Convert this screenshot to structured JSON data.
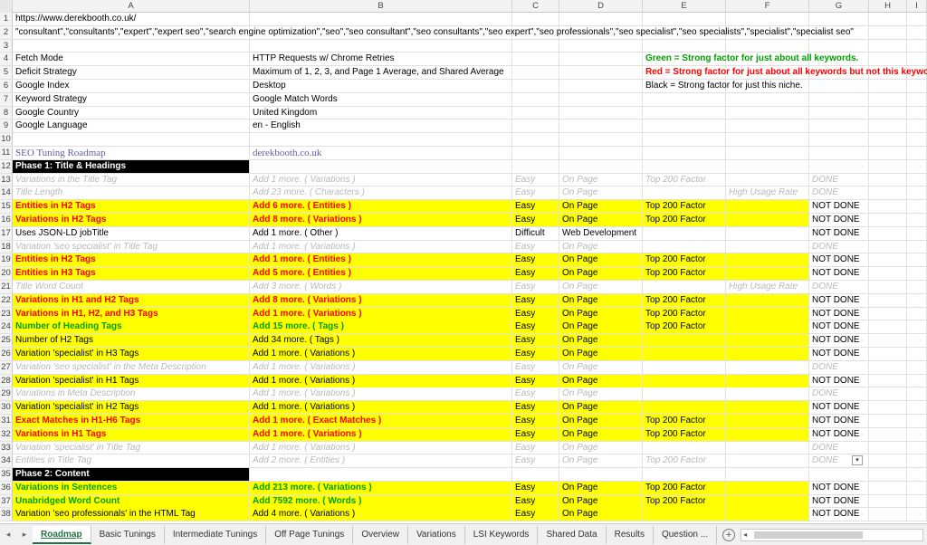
{
  "columns": [
    "",
    "A",
    "B",
    "C",
    "D",
    "E",
    "F",
    "G",
    "H",
    "I"
  ],
  "url": "https://www.derekbooth.co.uk/",
  "keywords": "\"consultant\",\"consultants\",\"expert\",\"expert seo\",\"search engine optimization\",\"seo\",\"seo consultant\",\"seo consultants\",\"seo expert\",\"seo professionals\",\"seo specialist\",\"seo specialists\",\"specialist\",\"specialist seo\"",
  "settings": [
    {
      "label": "Fetch Mode",
      "value": "HTTP Requests w/ Chrome Retries"
    },
    {
      "label": "Deficit Strategy",
      "value": "Maximum of 1, 2, 3, and Page 1 Average, and Shared Average"
    },
    {
      "label": "Google Index",
      "value": "Desktop"
    },
    {
      "label": "Keyword Strategy",
      "value": "Google Match Words"
    },
    {
      "label": "Google Country",
      "value": "United Kingdom"
    },
    {
      "label": "Google Language",
      "value": "en - English"
    }
  ],
  "legend": {
    "green": "Green = Strong factor for just about all keywords.",
    "red": "Red = Strong factor for just about all keywords but not this keyword.",
    "black": "Black = Strong factor for just this niche."
  },
  "roadmap_title": "SEO Tuning Roadmap",
  "site": "derekbooth.co.uk",
  "phase1": "Phase 1: Title & Headings",
  "phase2": "Phase 2: Content",
  "rows_p1": [
    {
      "n": "13",
      "style": "grey",
      "a": "Variations in the Title Tag",
      "b": "Add 1 more. ( Variations )",
      "c": "Easy",
      "d": "On Page",
      "e": "Top 200 Factor",
      "f": "",
      "g": "DONE"
    },
    {
      "n": "14",
      "style": "grey",
      "a": "Title Length",
      "b": "Add 23 more. ( Characters )",
      "c": "Easy",
      "d": "On Page",
      "e": "",
      "f": "High Usage Rate",
      "g": "DONE"
    },
    {
      "n": "15",
      "style": "red",
      "a": "Entities in H2 Tags",
      "b": "Add 6 more. ( Entities )",
      "c": "Easy",
      "d": "On Page",
      "e": "Top 200 Factor",
      "f": "",
      "g": "NOT DONE"
    },
    {
      "n": "16",
      "style": "red",
      "a": "Variations in H2 Tags",
      "b": "Add 8 more. ( Variations )",
      "c": "Easy",
      "d": "On Page",
      "e": "Top 200 Factor",
      "f": "",
      "g": "NOT DONE"
    },
    {
      "n": "17",
      "style": "plain",
      "a": "Uses JSON-LD jobTitle",
      "b": "Add 1 more. ( Other )",
      "c": "Difficult",
      "d": "Web Development",
      "e": "",
      "f": "",
      "g": "NOT DONE"
    },
    {
      "n": "18",
      "style": "grey",
      "a": "Variation 'seo specialist' in Title Tag",
      "b": "Add 1 more. ( Variations )",
      "c": "Easy",
      "d": "On Page",
      "e": "",
      "f": "",
      "g": "DONE"
    },
    {
      "n": "19",
      "style": "red",
      "a": "Entities in H2 Tags",
      "b": "Add 1 more. ( Entities )",
      "c": "Easy",
      "d": "On Page",
      "e": "Top 200 Factor",
      "f": "",
      "g": "NOT DONE"
    },
    {
      "n": "20",
      "style": "red",
      "a": "Entities in H3 Tags",
      "b": "Add 5 more. ( Entities )",
      "c": "Easy",
      "d": "On Page",
      "e": "Top 200 Factor",
      "f": "",
      "g": "NOT DONE"
    },
    {
      "n": "21",
      "style": "grey",
      "a": "Title Word Count",
      "b": "Add 3 more. ( Words )",
      "c": "Easy",
      "d": "On Page",
      "e": "",
      "f": "High Usage Rate",
      "g": "DONE"
    },
    {
      "n": "22",
      "style": "red",
      "a": "Variations in H1 and H2 Tags",
      "b": "Add 8 more. ( Variations )",
      "c": "Easy",
      "d": "On Page",
      "e": "Top 200 Factor",
      "f": "",
      "g": "NOT DONE"
    },
    {
      "n": "23",
      "style": "red",
      "a": "Variations in H1, H2, and H3 Tags",
      "b": "Add 1 more. ( Variations )",
      "c": "Easy",
      "d": "On Page",
      "e": "Top 200 Factor",
      "f": "",
      "g": "NOT DONE"
    },
    {
      "n": "24",
      "style": "green",
      "a": "Number of Heading Tags",
      "b": "Add 15 more. ( Tags )",
      "c": "Easy",
      "d": "On Page",
      "e": "Top 200 Factor",
      "f": "",
      "g": "NOT DONE"
    },
    {
      "n": "25",
      "style": "yplain",
      "a": "Number of H2 Tags",
      "b": "Add 34 more. ( Tags )",
      "c": "Easy",
      "d": "On Page",
      "e": "",
      "f": "",
      "g": "NOT DONE"
    },
    {
      "n": "26",
      "style": "yplain",
      "a": "Variation 'specialist' in H3 Tags",
      "b": "Add 1 more. ( Variations )",
      "c": "Easy",
      "d": "On Page",
      "e": "",
      "f": "",
      "g": "NOT DONE"
    },
    {
      "n": "27",
      "style": "grey",
      "a": "Variation 'seo specialist' in the Meta Description",
      "b": "Add 1 more. ( Variations )",
      "c": "Easy",
      "d": "On Page",
      "e": "",
      "f": "",
      "g": "DONE"
    },
    {
      "n": "28",
      "style": "yplain",
      "a": "Variation 'specialist' in H1 Tags",
      "b": "Add 1 more. ( Variations )",
      "c": "Easy",
      "d": "On Page",
      "e": "",
      "f": "",
      "g": "NOT DONE"
    },
    {
      "n": "29",
      "style": "grey",
      "a": "Variations in Meta Description",
      "b": "Add 1 more. ( Variations )",
      "c": "Easy",
      "d": "On Page",
      "e": "",
      "f": "",
      "g": "DONE"
    },
    {
      "n": "30",
      "style": "yplain",
      "a": "Variation 'specialist' in H2 Tags",
      "b": "Add 1 more. ( Variations )",
      "c": "Easy",
      "d": "On Page",
      "e": "",
      "f": "",
      "g": "NOT DONE"
    },
    {
      "n": "31",
      "style": "red",
      "a": "Exact Matches in H1-H6 Tags",
      "b": "Add 1 more. ( Exact Matches )",
      "c": "Easy",
      "d": "On Page",
      "e": "Top 200 Factor",
      "f": "",
      "g": "NOT DONE"
    },
    {
      "n": "32",
      "style": "red",
      "a": "Variations in H1 Tags",
      "b": "Add 1 more. ( Variations )",
      "c": "Easy",
      "d": "On Page",
      "e": "Top 200 Factor",
      "f": "",
      "g": "NOT DONE"
    },
    {
      "n": "33",
      "style": "grey",
      "a": "Variation 'specialist' in Title Tag",
      "b": "Add 1 more. ( Variations )",
      "c": "Easy",
      "d": "On Page",
      "e": "",
      "f": "",
      "g": "DONE"
    },
    {
      "n": "34",
      "style": "grey",
      "a": "Entities in Title Tag",
      "b": "Add 2 more. ( Entities )",
      "c": "Easy",
      "d": "On Page",
      "e": "Top 200 Factor",
      "f": "",
      "g": "DONE"
    }
  ],
  "rows_p2": [
    {
      "n": "36",
      "style": "green",
      "a": "Variations in Sentences",
      "b": "Add 213 more. ( Variations )",
      "c": "Easy",
      "d": "On Page",
      "e": "Top 200 Factor",
      "f": "",
      "g": "NOT DONE"
    },
    {
      "n": "37",
      "style": "green",
      "a": "Unabridged Word Count",
      "b": "Add 7592 more. ( Words )",
      "c": "Easy",
      "d": "On Page",
      "e": "Top 200 Factor",
      "f": "",
      "g": "NOT DONE"
    },
    {
      "n": "38",
      "style": "yplain",
      "a": "Variation 'seo professionals' in the HTML Tag",
      "b": "Add 4 more. ( Variations )",
      "c": "Easy",
      "d": "On Page",
      "e": "",
      "f": "",
      "g": "NOT DONE"
    }
  ],
  "dropdown_glyph": "▾",
  "tabs": [
    "Roadmap",
    "Basic Tunings",
    "Intermediate Tunings",
    "Off Page Tunings",
    "Overview",
    "Variations",
    "LSI Keywords",
    "Shared Data",
    "Results",
    "Question ..."
  ],
  "nav": {
    "prev": "◂",
    "next": "▸",
    "add": "+",
    "scroll_left": "◂"
  }
}
